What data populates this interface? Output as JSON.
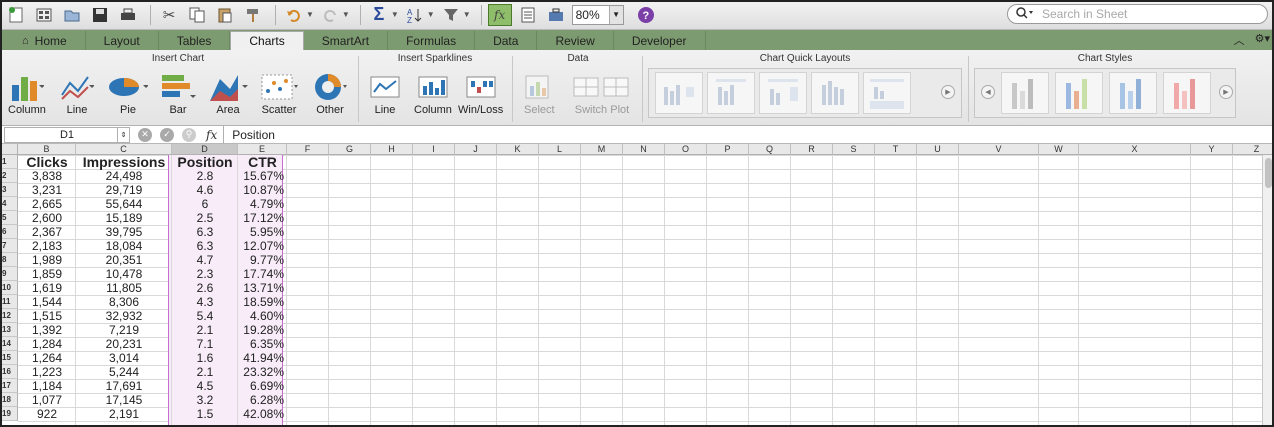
{
  "toolbar": {
    "icons": [
      "new-sheet-icon",
      "gallery-icon",
      "open-icon",
      "save-icon",
      "print-icon",
      "cut-icon",
      "copy-icon",
      "paste-icon",
      "format-painter-icon",
      "undo-icon",
      "redo-icon",
      "autosum-icon",
      "sort-icon",
      "filter-icon",
      "formula-builder-icon",
      "show-hide-icon",
      "toolbox-icon",
      "help-icon"
    ],
    "zoom": "80%",
    "search_placeholder": "Search in Sheet"
  },
  "tabs": [
    "Home",
    "Layout",
    "Tables",
    "Charts",
    "SmartArt",
    "Formulas",
    "Data",
    "Review",
    "Developer"
  ],
  "active_tab": "Charts",
  "ribbon": {
    "insert_chart": {
      "title": "Insert Chart",
      "buttons": [
        "Column",
        "Line",
        "Pie",
        "Bar",
        "Area",
        "Scatter",
        "Other"
      ]
    },
    "insert_sparklines": {
      "title": "Insert Sparklines",
      "buttons": [
        "Line",
        "Column",
        "Win/Loss"
      ]
    },
    "data": {
      "title": "Data",
      "buttons": [
        "Select",
        "Switch Plot"
      ]
    },
    "quick_layouts": {
      "title": "Chart Quick Layouts"
    },
    "chart_styles": {
      "title": "Chart Styles"
    }
  },
  "formula_bar": {
    "name_box": "D1",
    "fx": "fx",
    "formula": "Position"
  },
  "columns": [
    "B",
    "C",
    "D",
    "E",
    "F",
    "G",
    "H",
    "I",
    "J",
    "K",
    "L",
    "M",
    "N",
    "O",
    "P",
    "Q",
    "R",
    "S",
    "T",
    "U",
    "V",
    "W",
    "X",
    "Y",
    "Z"
  ],
  "rows": [
    "1",
    "2",
    "3",
    "4",
    "5",
    "6",
    "7",
    "8",
    "9",
    "10",
    "11",
    "12",
    "13",
    "14",
    "15",
    "16",
    "17",
    "18",
    "19"
  ],
  "table": {
    "headers": [
      "Clicks",
      "Impressions",
      "Position",
      "CTR"
    ],
    "rows": [
      [
        "3,838",
        "24,498",
        "2.8",
        "15.67%"
      ],
      [
        "3,231",
        "29,719",
        "4.6",
        "10.87%"
      ],
      [
        "2,665",
        "55,644",
        "6",
        "4.79%"
      ],
      [
        "2,600",
        "15,189",
        "2.5",
        "17.12%"
      ],
      [
        "2,367",
        "39,795",
        "6.3",
        "5.95%"
      ],
      [
        "2,183",
        "18,084",
        "6.3",
        "12.07%"
      ],
      [
        "1,989",
        "20,351",
        "4.7",
        "9.77%"
      ],
      [
        "1,859",
        "10,478",
        "2.3",
        "17.74%"
      ],
      [
        "1,619",
        "11,805",
        "2.6",
        "13.71%"
      ],
      [
        "1,544",
        "8,306",
        "4.3",
        "18.59%"
      ],
      [
        "1,515",
        "32,932",
        "5.4",
        "4.60%"
      ],
      [
        "1,392",
        "7,219",
        "2.1",
        "19.28%"
      ],
      [
        "1,284",
        "20,231",
        "7.1",
        "6.35%"
      ],
      [
        "1,264",
        "3,014",
        "1.6",
        "41.94%"
      ],
      [
        "1,223",
        "5,244",
        "2.1",
        "23.32%"
      ],
      [
        "1,184",
        "17,691",
        "4.5",
        "6.69%"
      ],
      [
        "1,077",
        "17,145",
        "3.2",
        "6.28%"
      ],
      [
        "922",
        "2,191",
        "1.5",
        "42.08%"
      ]
    ]
  },
  "colors": {
    "tab_bar": "#7d9b70",
    "selection": "#c86dd0",
    "selection_fill": "#f7ecf8"
  }
}
